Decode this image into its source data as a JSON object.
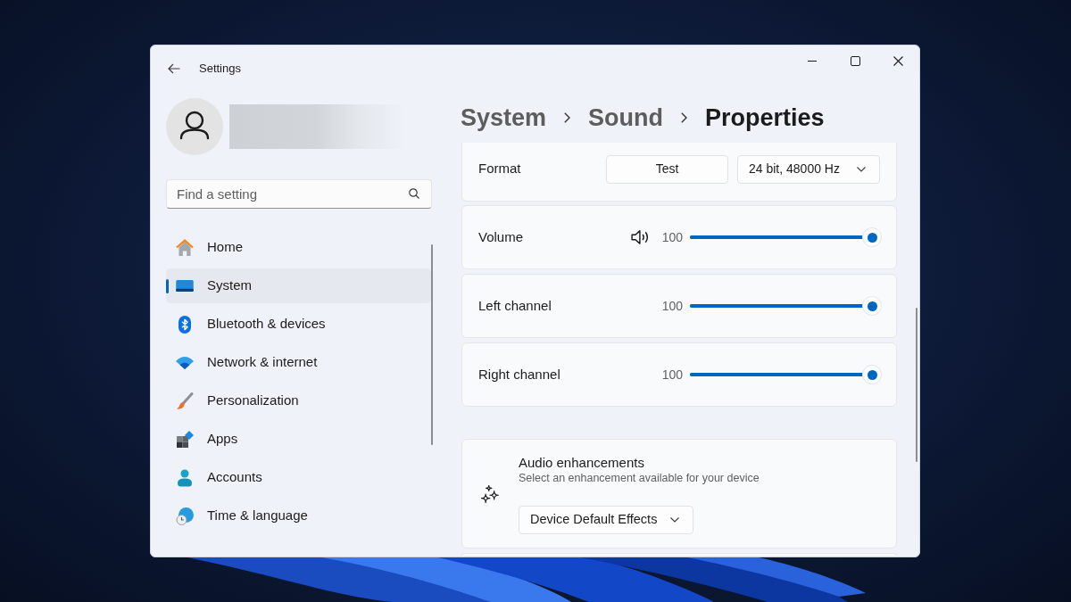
{
  "window": {
    "title": "Settings"
  },
  "search": {
    "placeholder": "Find a setting"
  },
  "sidebar": {
    "items": [
      {
        "label": "Home",
        "selected": false
      },
      {
        "label": "System",
        "selected": true
      },
      {
        "label": "Bluetooth & devices",
        "selected": false
      },
      {
        "label": "Network & internet",
        "selected": false
      },
      {
        "label": "Personalization",
        "selected": false
      },
      {
        "label": "Apps",
        "selected": false
      },
      {
        "label": "Accounts",
        "selected": false
      },
      {
        "label": "Time & language",
        "selected": false
      }
    ]
  },
  "breadcrumb": [
    {
      "label": "System",
      "current": false
    },
    {
      "label": "Sound",
      "current": false
    },
    {
      "label": "Properties",
      "current": true
    }
  ],
  "format": {
    "label": "Format",
    "button": "Test",
    "dropdown": "24 bit, 48000 Hz"
  },
  "sliders": [
    {
      "kind": "volume",
      "label": "Volume",
      "reading": "100",
      "level": 1
    },
    {
      "kind": "channel",
      "label": "Left channel",
      "reading": "100",
      "level": 1
    },
    {
      "kind": "channel",
      "label": "Right channel",
      "reading": "100",
      "level": 1
    }
  ],
  "enhancements": {
    "title": "Audio enhancements",
    "description": "Select an enhancement available for your device",
    "dropdown": "Device Default Effects"
  }
}
